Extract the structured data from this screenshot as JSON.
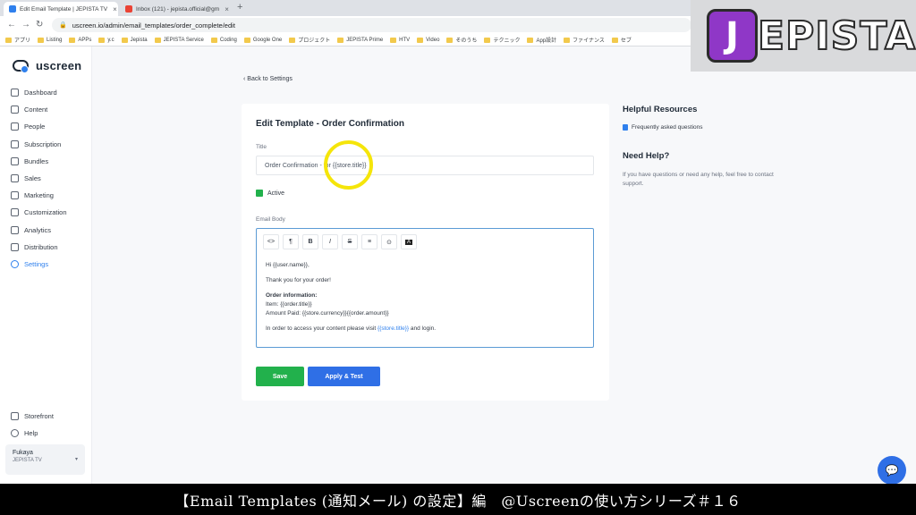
{
  "browser": {
    "tabs": [
      {
        "label": "Edit Email Template | JEPISTA TV",
        "active": true
      },
      {
        "label": "Inbox (121) - jepista.official@gm",
        "active": false
      }
    ],
    "url": "uscreen.io/admin/email_templates/order_complete/edit",
    "bookmarks": [
      "アプリ",
      "Listing",
      "APPs",
      "y.c",
      "Jepista",
      "JEPISTA Service",
      "Coding",
      "Google One",
      "プロジェクト",
      "JEPISTA Prime",
      "HTV",
      "Video",
      "そのうち",
      "テクニック",
      "App設計",
      "ファイナンス",
      "セブ"
    ]
  },
  "logo": {
    "first": "J",
    "rest": "EPISTA",
    "accent": "#8f37c7"
  },
  "sidebar": {
    "brand": "uscreen",
    "items": [
      {
        "label": "Dashboard",
        "icon": "dashboard-icon"
      },
      {
        "label": "Content",
        "icon": "folder-icon"
      },
      {
        "label": "People",
        "icon": "people-icon"
      },
      {
        "label": "Subscription",
        "icon": "refresh-icon"
      },
      {
        "label": "Bundles",
        "icon": "box-icon"
      },
      {
        "label": "Sales",
        "icon": "dollar-icon"
      },
      {
        "label": "Marketing",
        "icon": "megaphone-icon"
      },
      {
        "label": "Customization",
        "icon": "edit-icon"
      },
      {
        "label": "Analytics",
        "icon": "chart-icon"
      },
      {
        "label": "Distribution",
        "icon": "share-icon"
      },
      {
        "label": "Settings",
        "icon": "gear-icon",
        "active": true
      }
    ],
    "bottom": [
      {
        "label": "Storefront",
        "icon": "store-icon"
      },
      {
        "label": "Help",
        "icon": "help-icon"
      }
    ],
    "account": {
      "name": "Fukaya",
      "sub": "JEPISTA TV"
    }
  },
  "main": {
    "back": "Back to Settings",
    "card_title": "Edit Template - Order Confirmation",
    "title_label": "Title",
    "title_value": "Order Confirmation - for {{store.title}}",
    "active_label": "Active",
    "email_body_label": "Email Body",
    "toolbar": [
      "<>",
      "¶",
      "B",
      "I",
      "S",
      "≡",
      "⊙",
      "A"
    ],
    "body": {
      "greeting": "Hi {{user.name}},",
      "thanks": "Thank you for your order!",
      "order_heading": "Order information:",
      "item": "Item: {{order.title}}",
      "amount": "Amount Paid: {{store.currency}}{{order.amount}}",
      "access_prefix": "In order to access your content please visit ",
      "access_link": "{{store.title}}",
      "access_suffix": " and login."
    },
    "save": "Save",
    "apply_test": "Apply & Test"
  },
  "resources": {
    "title": "Helpful Resources",
    "link": "Frequently asked questions",
    "help_title": "Need Help?",
    "help_text": "If you have questions or need any help, feel free to contact support."
  },
  "caption": "【Email Templates (通知メール) の設定】編　@Uscreenの使い方シリーズ＃１６"
}
